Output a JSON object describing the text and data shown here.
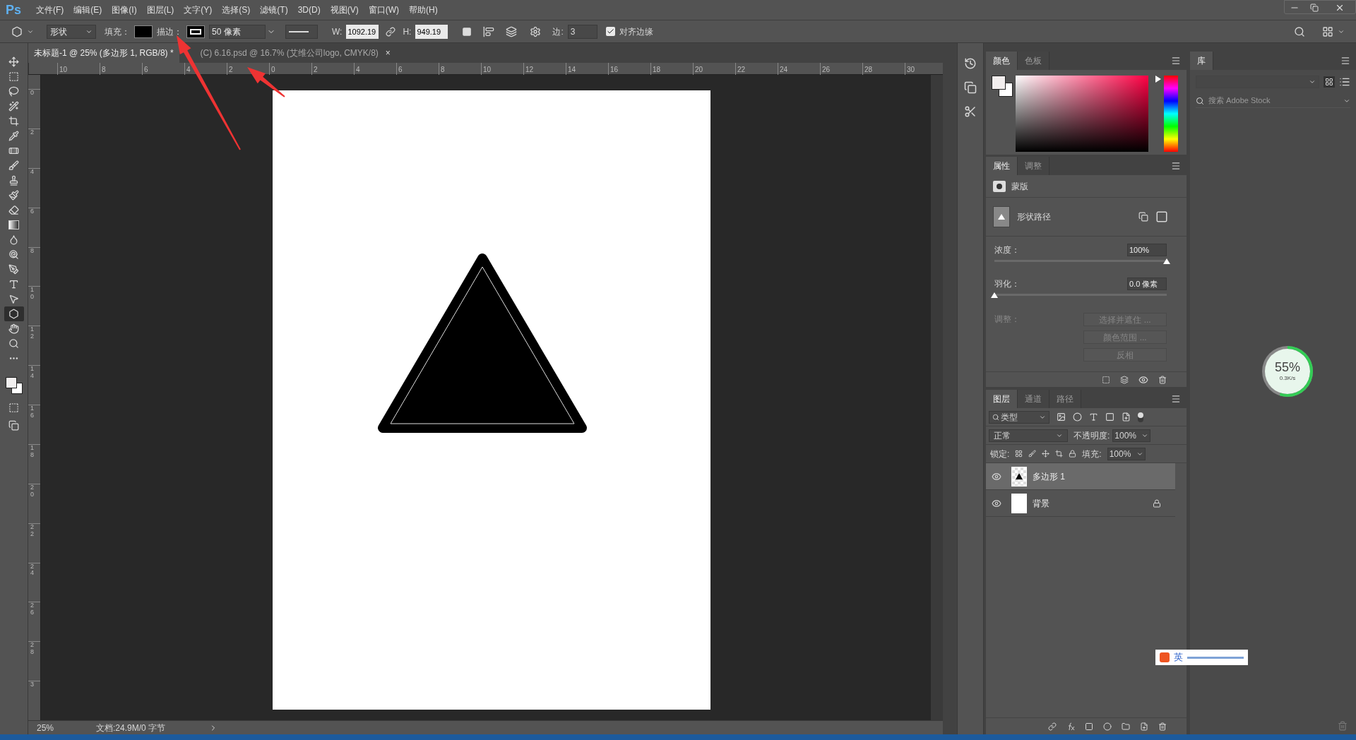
{
  "app_logo": "Ps",
  "menu": [
    "文件(F)",
    "编辑(E)",
    "图像(I)",
    "图层(L)",
    "文字(Y)",
    "选择(S)",
    "滤镜(T)",
    "3D(D)",
    "视图(V)",
    "窗口(W)",
    "帮助(H)"
  ],
  "options_bar": {
    "mode": "形状",
    "fill_label": "填充：",
    "stroke_label": "描边：",
    "stroke_width": "50 像素",
    "w_label": "W:",
    "w_value": "1092.19",
    "h_label": "H:",
    "h_value": "949.19",
    "sides_label": "边:",
    "sides_value": "3",
    "align_edges": {
      "label": "对齐边缘",
      "checked": true
    }
  },
  "document_tabs": [
    {
      "title": "未标题-1 @ 25% (多边形 1, RGB/8) *",
      "selected": true
    },
    {
      "title": "(C) 6.16.psd @ 16.7% (艾维公司logo, CMYK/8)",
      "selected": false,
      "close": "×"
    }
  ],
  "rulers": {
    "horizontal": [
      "10",
      "8",
      "6",
      "4",
      "2",
      "0",
      "2",
      "4",
      "6",
      "8",
      "10",
      "12",
      "14",
      "16",
      "18",
      "20",
      "22",
      "24",
      "26",
      "28",
      "30"
    ],
    "vertical": [
      "0",
      "2",
      "4",
      "6",
      "8",
      "10",
      "12",
      "14",
      "16",
      "18",
      "20",
      "22",
      "24",
      "26",
      "28",
      "3"
    ]
  },
  "tools": [
    {
      "kind": "move",
      "selected": false
    },
    {
      "kind": "marquee",
      "selected": false
    },
    {
      "kind": "lasso",
      "selected": false
    },
    {
      "kind": "quick_select",
      "selected": false
    },
    {
      "kind": "crop",
      "selected": false
    },
    {
      "kind": "eyedropper",
      "selected": false
    },
    {
      "kind": "healing",
      "selected": false
    },
    {
      "kind": "brush",
      "selected": false
    },
    {
      "kind": "stamp",
      "selected": false
    },
    {
      "kind": "history_brush",
      "selected": false
    },
    {
      "kind": "eraser",
      "selected": false
    },
    {
      "kind": "gradient",
      "selected": false
    },
    {
      "kind": "blur",
      "selected": false
    },
    {
      "kind": "dodge",
      "selected": false
    },
    {
      "kind": "pen",
      "selected": false
    },
    {
      "kind": "type",
      "selected": false
    },
    {
      "kind": "path_select",
      "selected": false
    },
    {
      "kind": "shape",
      "selected": true
    },
    {
      "kind": "hand",
      "selected": false
    },
    {
      "kind": "zoom",
      "selected": false
    },
    {
      "kind": "more",
      "selected": false
    }
  ],
  "status_bar": {
    "zoom": "25%",
    "doc_info": "文档:24.9M/0 字节"
  },
  "color_panel": {
    "tabs": [
      {
        "label": "颜色",
        "selected": true
      },
      {
        "label": "色板",
        "selected": false
      }
    ]
  },
  "properties_panel": {
    "tabs": [
      {
        "label": "属性",
        "selected": true
      },
      {
        "label": "调整",
        "selected": false
      }
    ],
    "mask_label": "蒙版",
    "path_label": "形状路径",
    "sliders": [
      {
        "label": "浓度：",
        "value": "100%",
        "level": 1
      },
      {
        "label": "羽化：",
        "value": "0.0 像素",
        "level": 0
      }
    ],
    "adjust_label": "调整：",
    "buttons": [
      {
        "label": "选择并遮住 ...",
        "disabled": true
      },
      {
        "label": "颜色范围 ...",
        "disabled": true
      },
      {
        "label": "反相",
        "disabled": true
      }
    ]
  },
  "library_panel": {
    "tabs": [
      {
        "label": "库",
        "selected": true
      }
    ],
    "search_placeholder": "搜索 Adobe Stock"
  },
  "layers_panel": {
    "tabs": [
      {
        "label": "图层",
        "selected": true
      },
      {
        "label": "通道",
        "selected": false
      },
      {
        "label": "路径",
        "selected": false
      }
    ],
    "filter": "类型",
    "blend_mode": "正常",
    "opacity_label": "不透明度:",
    "opacity": "100%",
    "lock_label": "锁定:",
    "fill_label": "填充:",
    "fill": "100%",
    "layers": [
      {
        "name": "多边形 1",
        "kind": "shape",
        "selected": true,
        "visible": true,
        "locked": false
      },
      {
        "name": "背景",
        "kind": "background",
        "selected": false,
        "visible": true,
        "locked": true
      }
    ]
  },
  "speed_meter": {
    "percent": "55%",
    "rate": "0.3K/s",
    "level": 0.55
  },
  "ime_bar": {
    "label": "英"
  }
}
